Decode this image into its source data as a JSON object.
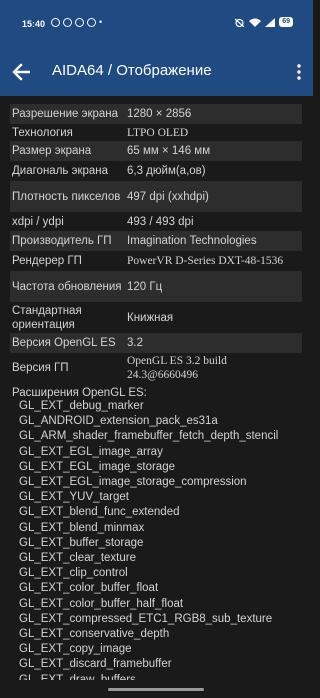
{
  "status": {
    "time": "15:40",
    "battery": "69"
  },
  "appbar": {
    "title": "AIDA64  /  Отображение"
  },
  "rows": [
    {
      "k": "Разрешение экрана",
      "v": "1280 × 2856"
    },
    {
      "k": "Технология",
      "v": "LTPO OLED"
    },
    {
      "k": "Размер экрана",
      "v": "65 мм × 146 мм"
    },
    {
      "k": "Диагональ экрана",
      "v": "6,3 дюйм(а,ов)"
    },
    {
      "k": "Плотность пикселов",
      "v": "497 dpi (xxhdpi)"
    },
    {
      "k": "xdpi / ydpi",
      "v": "493 / 493 dpi"
    },
    {
      "k": "Производитель ГП",
      "v": "Imagination Technologies"
    },
    {
      "k": "Рендерер ГП",
      "v": "PowerVR D-Series DXT-48-1536"
    },
    {
      "k": "Частота обновления",
      "v": "120 Гц"
    },
    {
      "k": "Стандартная ориентация",
      "v": "Книжная"
    },
    {
      "k": "Версия OpenGL ES",
      "v": "3.2"
    },
    {
      "k": "Версия ГП",
      "v": "OpenGL ES 3.2 build 24.3@6660496"
    }
  ],
  "extensions_title": "Расширения OpenGL ES:",
  "extensions": [
    "GL_EXT_debug_marker",
    "GL_ANDROID_extension_pack_es31a",
    "GL_ARM_shader_framebuffer_fetch_depth_stencil",
    "GL_EXT_EGL_image_array",
    "GL_EXT_EGL_image_storage",
    "GL_EXT_EGL_image_storage_compression",
    "GL_EXT_YUV_target",
    "GL_EXT_blend_func_extended",
    "GL_EXT_blend_minmax",
    "GL_EXT_buffer_storage",
    "GL_EXT_clear_texture",
    "GL_EXT_clip_control",
    "GL_EXT_color_buffer_float",
    "GL_EXT_color_buffer_half_float",
    "GL_EXT_compressed_ETC1_RGB8_sub_texture",
    "GL_EXT_conservative_depth",
    "GL_EXT_copy_image",
    "GL_EXT_discard_framebuffer",
    "GL_EXT_draw_buffers"
  ]
}
